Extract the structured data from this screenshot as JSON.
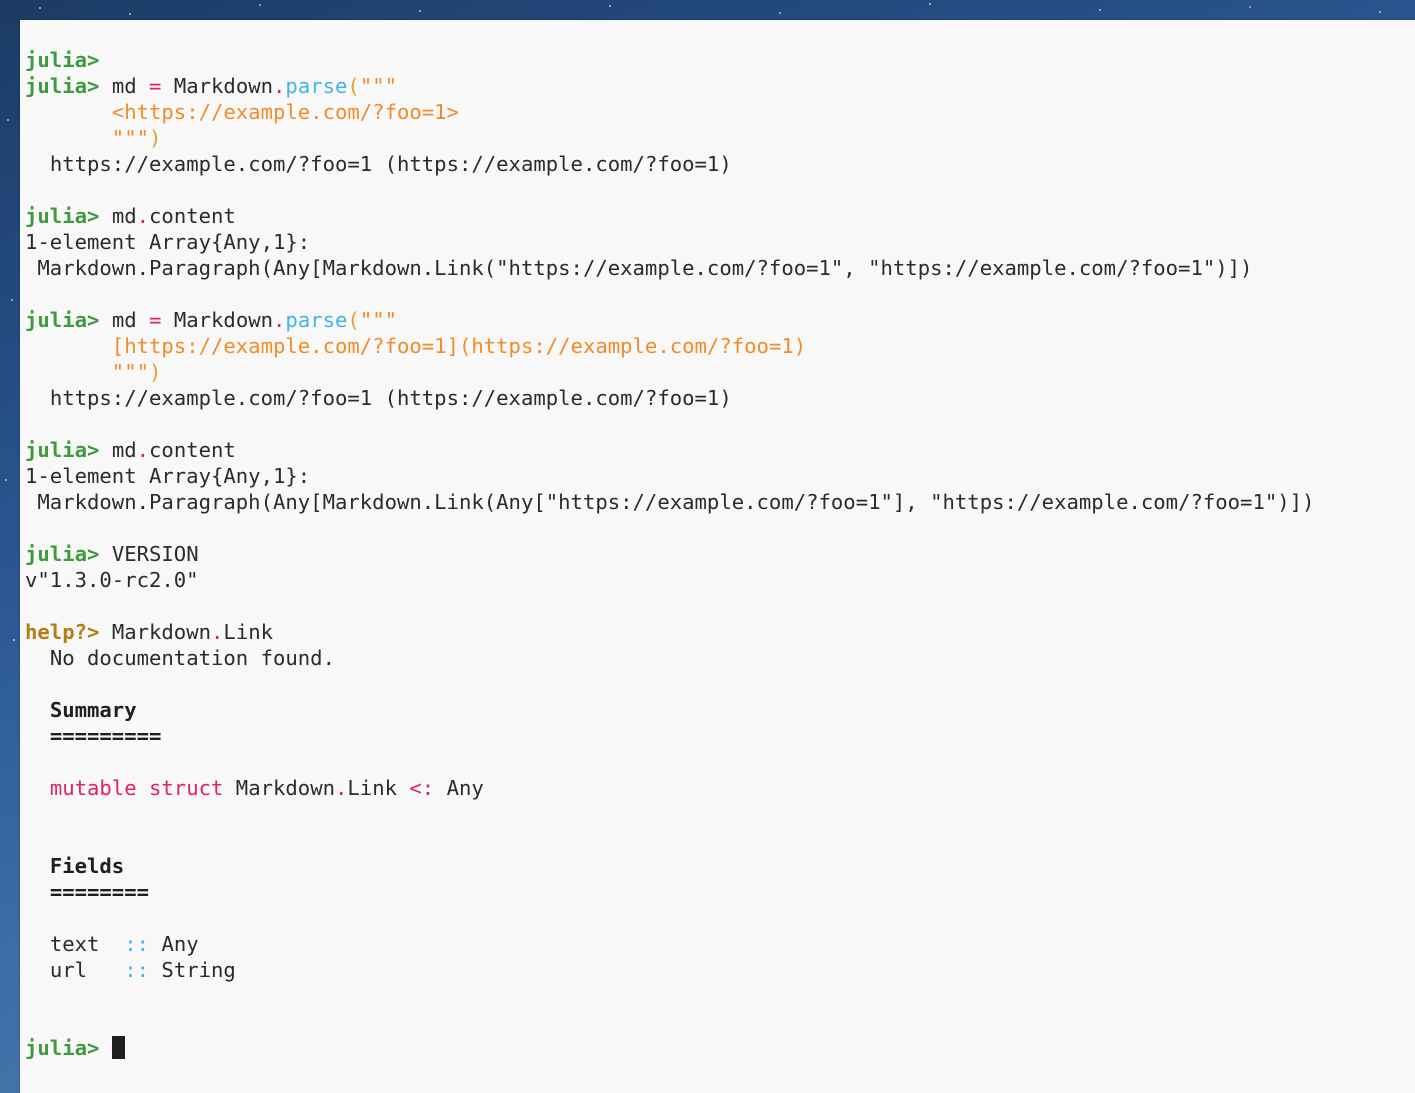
{
  "repl": {
    "prompt": "julia>",
    "help_prompt": "help?>",
    "line1": {
      "empty": ""
    },
    "cmd1": {
      "a": "md ",
      "eq": "=",
      "b": " Markdown",
      "dot": ".",
      "fn": "parse",
      "paren": "(",
      "q": "\"\"\""
    },
    "cmd1_str": "<https://example.com/?foo=1>",
    "cmd1_close": {
      "q": "\"\"\"",
      "paren": ")"
    },
    "out1": "https://example.com/?foo=1 (https://example.com/?foo=1)",
    "cmd2": {
      "a": "md",
      "dot": ".",
      "b": "content"
    },
    "out2a": "1-element Array{Any,1}:",
    "out2b": "Markdown.Paragraph(Any[Markdown.Link(\"https://example.com/?foo=1\", \"https://example.com/?foo=1\")])",
    "cmd3": {
      "a": "md ",
      "eq": "=",
      "b": " Markdown",
      "dot": ".",
      "fn": "parse",
      "paren": "(",
      "q": "\"\"\""
    },
    "cmd3_str": "[https://example.com/?foo=1](https://example.com/?foo=1)",
    "cmd3_close": {
      "q": "\"\"\"",
      "paren": ")"
    },
    "out3": "https://example.com/?foo=1 (https://example.com/?foo=1)",
    "cmd4": {
      "a": "md",
      "dot": ".",
      "b": "content"
    },
    "out4a": "1-element Array{Any,1}:",
    "out4b": "Markdown.Paragraph(Any[Markdown.Link(Any[\"https://example.com/?foo=1\"], \"https://example.com/?foo=1\")])",
    "cmd5": "VERSION",
    "out5": "v\"1.3.0-rc2.0\"",
    "help_cmd": {
      "a": "Markdown",
      "dot": ".",
      "b": "Link"
    },
    "help_out": "No documentation found.",
    "summary_heading": "Summary",
    "summary_rule": "=========",
    "struct_line": {
      "kw": "mutable struct",
      "name": " Markdown",
      "dot": ".",
      "name2": "Link ",
      "op": "<:",
      "super": " Any"
    },
    "fields_heading": "Fields",
    "fields_rule": "========",
    "fields": [
      {
        "name": "text",
        "pad": "  ",
        "sep": "::",
        "type": " Any"
      },
      {
        "name": "url",
        "pad": "   ",
        "sep": "::",
        "type": " String"
      }
    ]
  },
  "colors": {
    "prompt": "#3d9a3d",
    "help_prompt": "#b57d15",
    "string": "#f28c28",
    "keyword": "#e0245e",
    "function": "#41b6e6",
    "background": "#f8f8f8"
  }
}
